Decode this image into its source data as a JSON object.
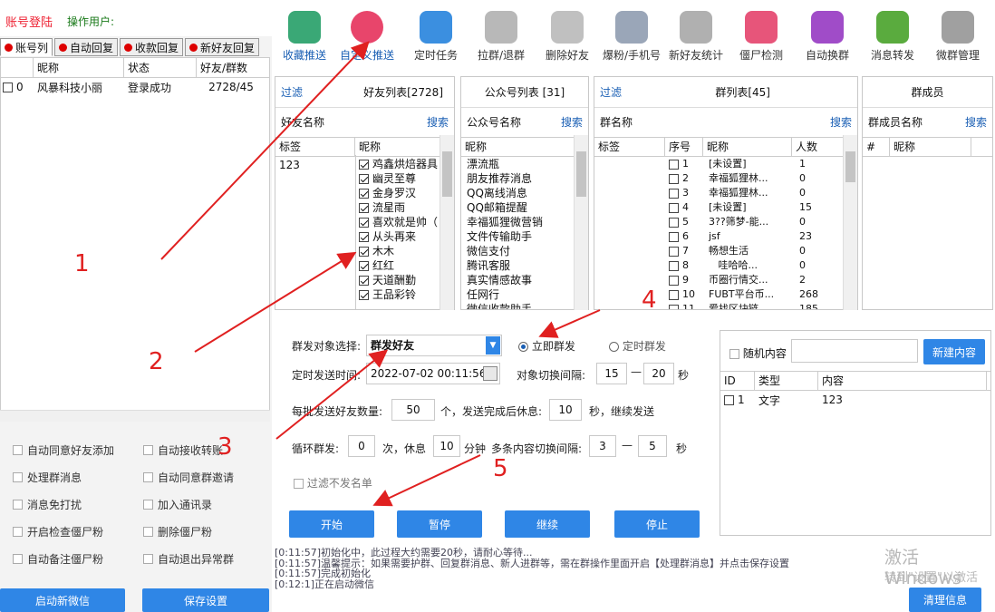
{
  "header": {
    "login": "账号登陆",
    "user_label": "操作用户:"
  },
  "left_tabs": [
    "账号列",
    "自动回复",
    "收款回复",
    "新好友回复"
  ],
  "account_table": {
    "headers": [
      "",
      "昵称",
      "状态",
      "好友/群数"
    ],
    "rows": [
      {
        "idx": "0",
        "nick": "风暴科技小丽",
        "status": "登录成功",
        "count": "2728/45"
      }
    ]
  },
  "options": {
    "auto_accept": "自动同意好友添加",
    "auto_receive": "自动接收转账",
    "handle_group": "处理群消息",
    "auto_invite": "自动同意群邀请",
    "mute": "消息免打扰",
    "add_contacts": "加入通讯录",
    "check_zombie": "开启检查僵尸粉",
    "delete_zombie": "删除僵尸粉",
    "note_zombie": "自动备注僵尸粉",
    "auto_quit": "自动退出异常群"
  },
  "left_buttons": {
    "start_wechat": "启动新微信",
    "save": "保存设置"
  },
  "toolbar": [
    {
      "label": "收藏推送",
      "icon": "bookmark-icon",
      "color": "#3aa876"
    },
    {
      "label": "自定义推送",
      "icon": "send-icon",
      "color": "#e8456b"
    },
    {
      "label": "定时任务",
      "icon": "id-card-icon",
      "color": "#3b8fe0"
    },
    {
      "label": "拉群/退群",
      "icon": "users-icon",
      "color": "#b8b8b8"
    },
    {
      "label": "删除好友",
      "icon": "delete-user-icon",
      "color": "#c0c0c0"
    },
    {
      "label": "爆粉/手机号",
      "icon": "phone-user-icon",
      "color": "#9aa6b8"
    },
    {
      "label": "新好友统计",
      "icon": "new-user-icon",
      "color": "#b0b0b0"
    },
    {
      "label": "僵尸检测",
      "icon": "zombie-face-icon",
      "color": "#e7557a"
    },
    {
      "label": "自动换群",
      "icon": "switch-group-icon",
      "color": "#a04cc8"
    },
    {
      "label": "消息转发",
      "icon": "forward-icon",
      "color": "#5aab3e"
    },
    {
      "label": "微群管理",
      "icon": "gear-icon",
      "color": "#a0a0a0"
    }
  ],
  "friends": {
    "filter": "过滤",
    "title": "好友列表[2728]",
    "name_label": "好友名称",
    "search": "搜索",
    "cols": [
      "标签",
      "昵称"
    ],
    "tag": "123",
    "items": [
      "鸡鑫烘焙器具",
      "幽灵至尊",
      "金身罗汉",
      "流星雨",
      "喜欢就是帅（",
      "从头再来",
      "木木",
      "红红",
      "天道酬勤",
      "王品彩铃"
    ]
  },
  "official": {
    "title": "公众号列表 [31]",
    "name_label": "公众号名称",
    "search": "搜索",
    "col": "昵称",
    "items": [
      "漂流瓶",
      "朋友推荐消息",
      "QQ离线消息",
      "QQ邮箱提醒",
      "幸福狐狸微营销",
      "文件传输助手",
      "微信支付",
      "腾讯客服",
      "真实情感故事",
      "任网行",
      "微信收款助手"
    ]
  },
  "groups": {
    "filter": "过滤",
    "title": "群列表[45]",
    "name_label": "群名称",
    "search": "搜索",
    "cols": [
      "标签",
      "序号",
      "昵称",
      "人数"
    ],
    "rows": [
      {
        "n": "1",
        "name": "[未设置]",
        "c": "1"
      },
      {
        "n": "2",
        "name": "幸福狐狸林...",
        "c": "0"
      },
      {
        "n": "3",
        "name": "幸福狐狸林...",
        "c": "0"
      },
      {
        "n": "4",
        "name": "[未设置]",
        "c": "15"
      },
      {
        "n": "5",
        "name": "3??筛梦-能...",
        "c": "0"
      },
      {
        "n": "6",
        "name": "jsf",
        "c": "23"
      },
      {
        "n": "7",
        "name": "畅想生活",
        "c": "0"
      },
      {
        "n": "8",
        "name": "   哇哈哈...",
        "c": "0"
      },
      {
        "n": "9",
        "name": "币圈行情交...",
        "c": "2"
      },
      {
        "n": "10",
        "name": "FUBT平台币...",
        "c": "268"
      },
      {
        "n": "11",
        "name": "爱找区块链",
        "c": "185"
      }
    ]
  },
  "members": {
    "title": "群成员",
    "name_label": "群成员名称",
    "search": "搜索",
    "cols": [
      "#",
      "昵称"
    ]
  },
  "settings": {
    "target_label": "群发对象选择:",
    "target_value": "群发好友",
    "instant": "立即群发",
    "scheduled": "定时群发",
    "time_label": "定时发送时间:",
    "time_value": "2022-07-02 00:11:56",
    "switch_label": "对象切换间隔:",
    "switch_from": "15",
    "dash": "—",
    "switch_to": "20",
    "sec": "秒",
    "batch_label": "每批发送好友数量:",
    "batch_value": "50",
    "batch_mid": "个，发送完成后休息:",
    "rest_value": "10",
    "batch_end": "秒，继续发送",
    "loop_label": "循环群发:",
    "loop_value": "0",
    "loop_mid": "次，休息",
    "loop_rest": "10",
    "loop_min": "分钟",
    "multi_label": "多条内容切换间隔:",
    "multi_from": "3",
    "multi_to": "5",
    "filter_label": "过滤不发名单"
  },
  "actions": {
    "start": "开始",
    "pause": "暂停",
    "resume": "继续",
    "stop": "停止"
  },
  "content": {
    "random": "随机内容",
    "new_btn": "新建内容",
    "cols": [
      "ID",
      "类型",
      "内容"
    ],
    "row": {
      "id": "1",
      "type": "文字",
      "content": "123"
    }
  },
  "log": [
    "[0:11:57]初始化中，此过程大约需要20秒，请耐心等待...",
    "[0:11:57]温馨提示：如果需要护群、回复群消息、新人进群等，需在群操作里面开启【处理群消息】并点击保存设置",
    "[0:11:57]完成初始化",
    "[0:12:1]正在启动微信"
  ],
  "watermark": {
    "line1": "激活 Windows",
    "line2": "转到\"设置\"以激活"
  },
  "clear_btn": "清理信息",
  "annotations": [
    "1",
    "2",
    "3",
    "4",
    "5"
  ],
  "colors": {
    "accent": "#2f86e6",
    "arrow": "#e02020"
  }
}
